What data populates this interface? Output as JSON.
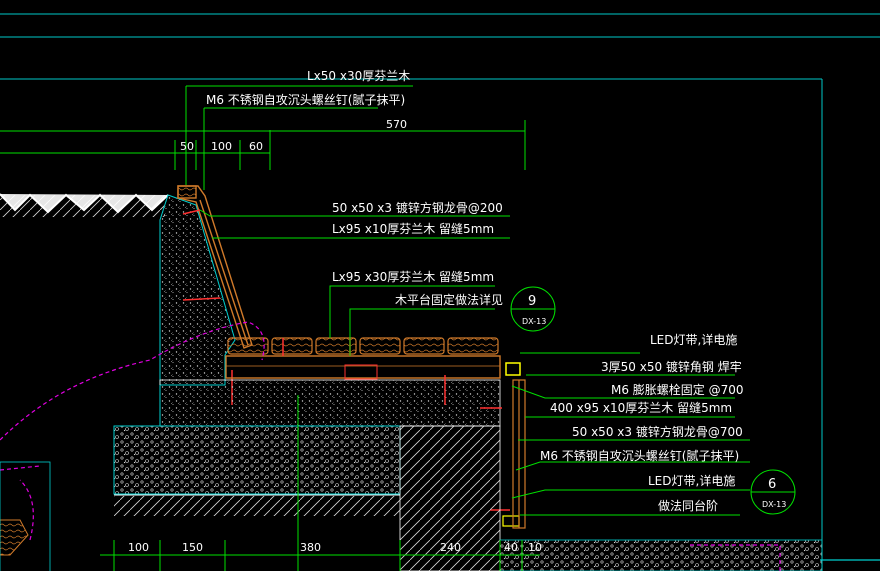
{
  "drawing": {
    "colors": {
      "background": "#000000",
      "leader": "#00e000",
      "frame": "#00c8c8",
      "concrete": "#00d0d0",
      "wood": "#d07a2a",
      "bolt": "#ff3030",
      "hatch": "#d8d8d8",
      "magenta": "#e000e0",
      "led": "#ffff00"
    },
    "top_labels": {
      "top_wood": "Lx50 x30厚芬兰木",
      "top_screw": "M6 不锈钢自攻沉头螺丝钉(腻子抹平)"
    },
    "dimensions_top": {
      "overall": "570",
      "d1": "50",
      "d2": "100",
      "d3": "60"
    },
    "callouts": {
      "c1": "50 x50 x3 镀锌方钢龙骨@200",
      "c2": "Lx95 x10厚芬兰木  留缝5mm",
      "c3": "Lx95 x30厚芬兰木  留缝5mm",
      "c4": "木平台固定做法详见",
      "c5": "LED灯带,详电施",
      "c6": "3厚50 x50 镀锌角钢  焊牢",
      "c7": "M6 膨胀螺栓固定  @700",
      "c8": "400 x95 x10厚芬兰木  留缝5mm",
      "c9": "50 x50 x3 镀锌方钢龙骨@700",
      "c10": "M6 不锈钢自攻沉头螺丝钉(腻子抹平)",
      "c11": "LED灯带,详电施",
      "c12": "做法同台阶"
    },
    "bubbles": {
      "b1": {
        "number": "9",
        "sheet": "DX-13"
      },
      "b2": {
        "number": "6",
        "sheet": "DX-13"
      }
    },
    "dimensions_bottom": {
      "d1": "100",
      "d2": "150",
      "d3": "380",
      "d4": "240",
      "d5": "40",
      "d6": "10"
    }
  }
}
